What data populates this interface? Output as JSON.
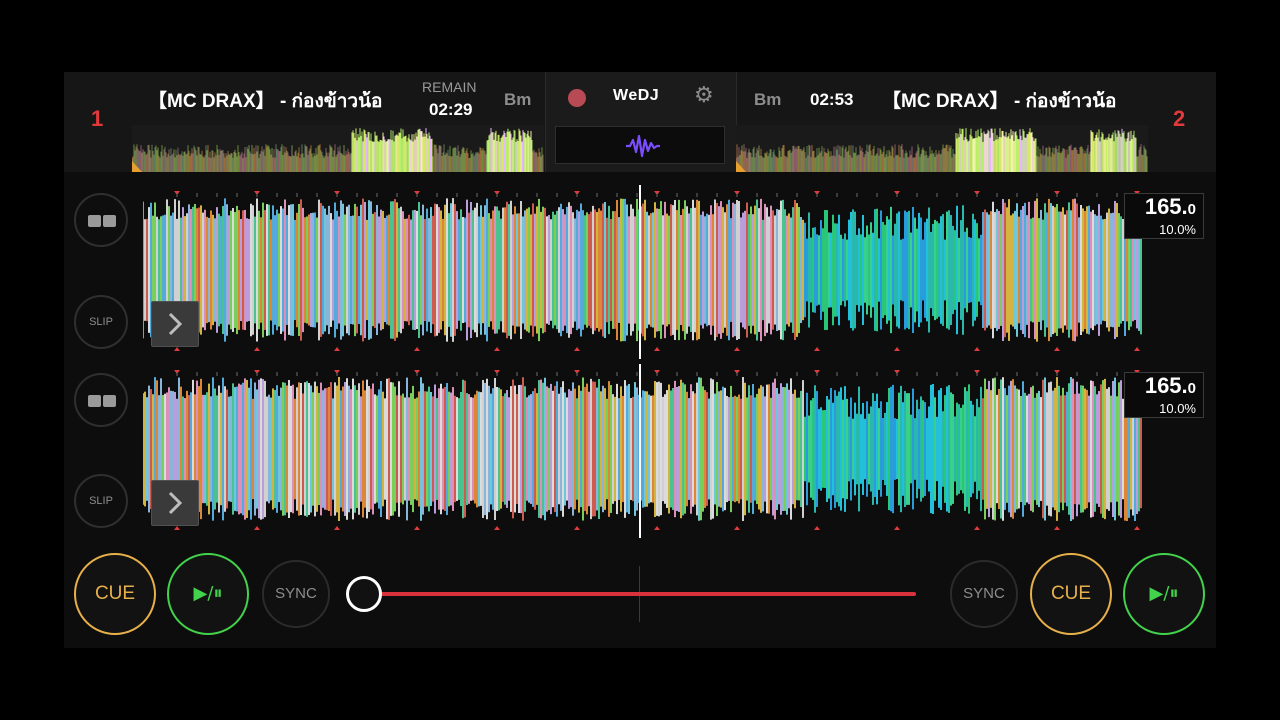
{
  "app": {
    "logo": "WeDJ",
    "icons": [
      "record-icon",
      "gear-icon",
      "waveform-icon"
    ]
  },
  "deck1": {
    "number": "1",
    "title": "【MC DRAX】 - ก่องข้าวน้อ",
    "remain_label": "REMAIN",
    "time": "02:29",
    "key": "Bm"
  },
  "deck2": {
    "number": "2",
    "title": "【MC DRAX】 - ก่องข้าวน้อ",
    "time": "02:53",
    "key": "Bm"
  },
  "waveform1": {
    "bpm": "165.",
    "bpm_decimal": "0",
    "pitch": "10.0%",
    "slip_label": "SLIP"
  },
  "waveform2": {
    "bpm": "165.",
    "bpm_decimal": "0",
    "pitch": "10.0%",
    "slip_label": "SLIP"
  },
  "controls": {
    "cue_left": "CUE",
    "play_left": "▶/⏸",
    "sync_left": "SYNC",
    "sync_right": "SYNC",
    "cue_right": "CUE",
    "play_right": "▶/⏸"
  },
  "crossfader": {
    "position": 0.0
  },
  "colors": {
    "accent_red": "#e23a3a",
    "cue": "#e7b04a",
    "play": "#43d24b",
    "crossfader": "#d8333c"
  }
}
